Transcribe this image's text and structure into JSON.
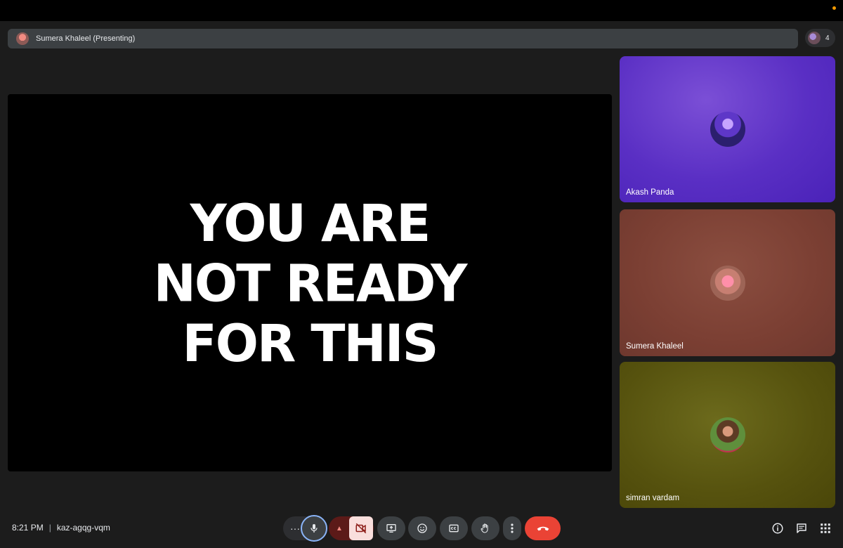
{
  "presenter_bar": {
    "label": "Sumera Khaleel (Presenting)"
  },
  "people_chip": {
    "count": "4"
  },
  "slide": {
    "lines": [
      "YOU ARE",
      "NOT READY",
      "FOR THIS"
    ]
  },
  "tiles": [
    {
      "name": "Akash Panda"
    },
    {
      "name": "Sumera Khaleel"
    },
    {
      "name": "simran vardam"
    }
  ],
  "meeting": {
    "time": "8:21 PM",
    "separator": "|",
    "code": "kaz-agqg-vqm"
  },
  "controls": {
    "more_options_label": "···"
  },
  "colors": {
    "accent": "#8ab4f8",
    "end_call": "#ea4335",
    "camera_off_bg": "#f9dedc",
    "camera_group_bg": "#5c1a18"
  }
}
